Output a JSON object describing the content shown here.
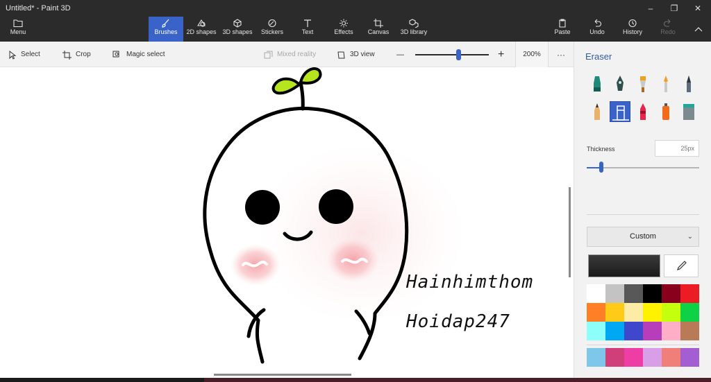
{
  "window": {
    "title": "Untitled* - Paint 3D",
    "buttons": [
      "–",
      "❐",
      "✕"
    ]
  },
  "ribbon": {
    "menu": "Menu",
    "tools": [
      {
        "label": "Brushes",
        "icon": "brush-icon"
      },
      {
        "label": "2D shapes",
        "icon": "2d-shapes-icon"
      },
      {
        "label": "3D shapes",
        "icon": "3d-shapes-icon"
      },
      {
        "label": "Stickers",
        "icon": "stickers-icon"
      },
      {
        "label": "Text",
        "icon": "text-icon"
      },
      {
        "label": "Effects",
        "icon": "effects-icon"
      },
      {
        "label": "Canvas",
        "icon": "canvas-icon"
      },
      {
        "label": "3D library",
        "icon": "3d-library-icon"
      }
    ],
    "paste": "Paste",
    "undo": "Undo",
    "history": "History",
    "redo": "Redo"
  },
  "toolbar": {
    "select": "Select",
    "crop": "Crop",
    "magic_select": "Magic select",
    "mixed_reality": "Mixed reality",
    "view_3d": "3D view",
    "zoom_minus": "—",
    "zoom_plus": "+",
    "zoom_level": "200%",
    "zoom_fraction": 0.6,
    "more": "···"
  },
  "canvas": {
    "text_line_1": "Hainhimthom",
    "text_line_2": "Hoidap247"
  },
  "panel": {
    "title": "Eraser",
    "thickness_label": "Thickness",
    "thickness_value": "25px",
    "thickness_fraction": 0.13,
    "color_mode": "Custom",
    "current_color": "#1a1a1a",
    "accent": "#3a63c9",
    "palette": [
      "#ffffff",
      "#c3c3c3",
      "#585858",
      "#000000",
      "#88001b",
      "#ec1c24",
      "#ff7f27",
      "#ffca18",
      "#fdeca6",
      "#fff200",
      "#c4ff0e",
      "#0ed145",
      "#8cfffb",
      "#00a8f3",
      "#3f48cc",
      "#b83dba",
      "#ffaec8",
      "#b97a56"
    ],
    "custom_palette": [
      "#7fc7ea",
      "#d13f7b",
      "#ee3ea6",
      "#d89ee8",
      "#f07f7a",
      "#a35fd1"
    ]
  }
}
